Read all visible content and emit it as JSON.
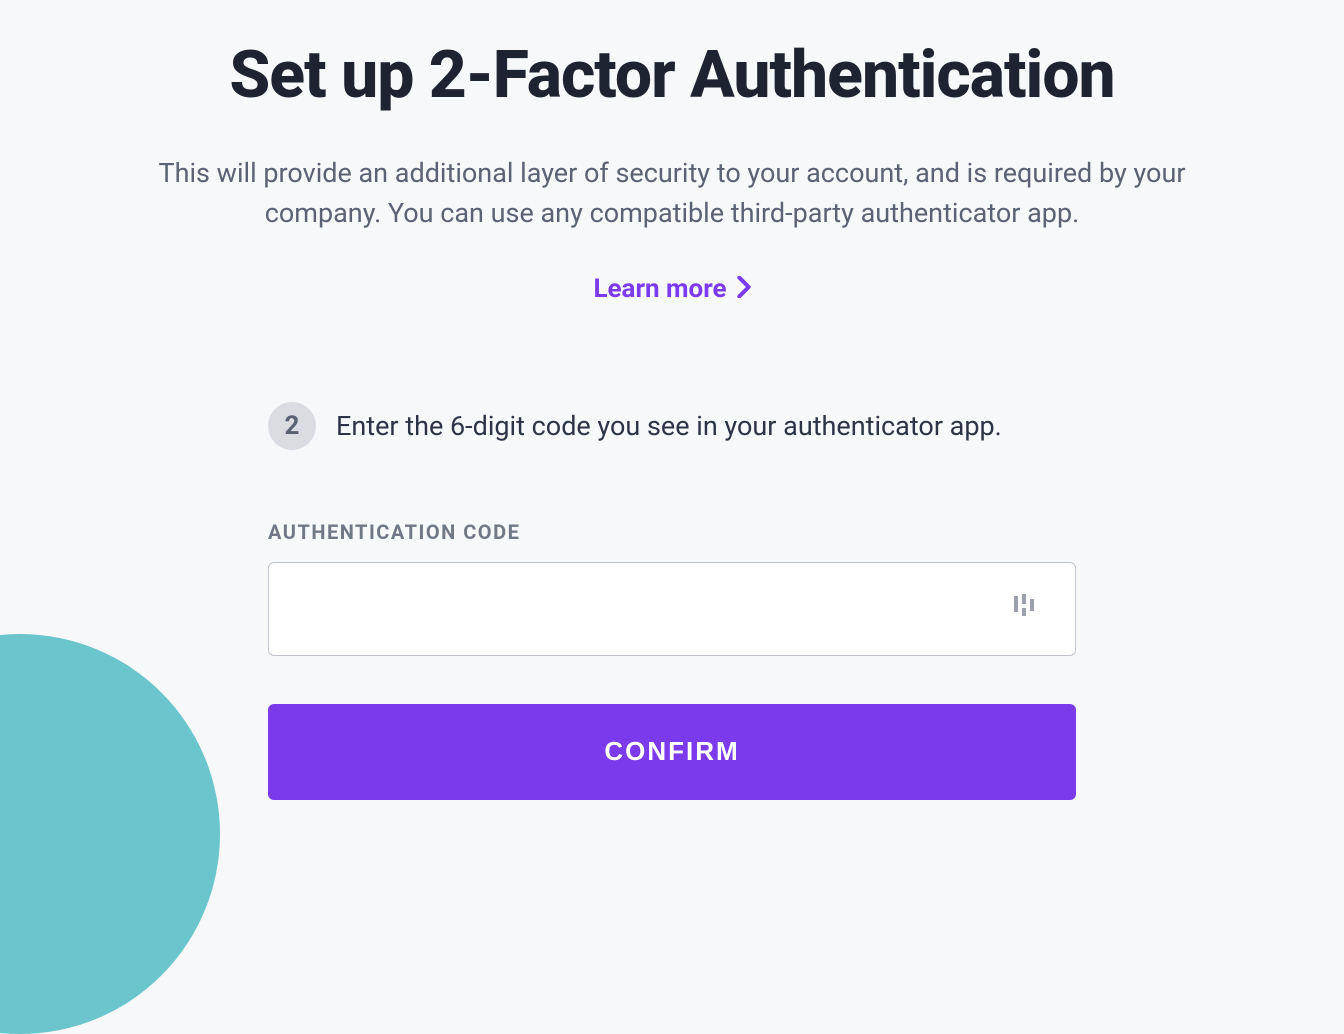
{
  "heading": "Set up 2-Factor Authentication",
  "subtitle": "This will provide an additional layer of security to your account, and is required by your company. You can use any compatible third-party authenticator app.",
  "learn_more_label": "Learn more",
  "step": {
    "number": "2",
    "text": "Enter the 6-digit code you see in your authenticator app."
  },
  "input": {
    "label": "AUTHENTICATION CODE",
    "value": ""
  },
  "confirm_label": "CONFIRM",
  "colors": {
    "accent": "#7c3aed",
    "decoration": "#6bc5cc"
  }
}
